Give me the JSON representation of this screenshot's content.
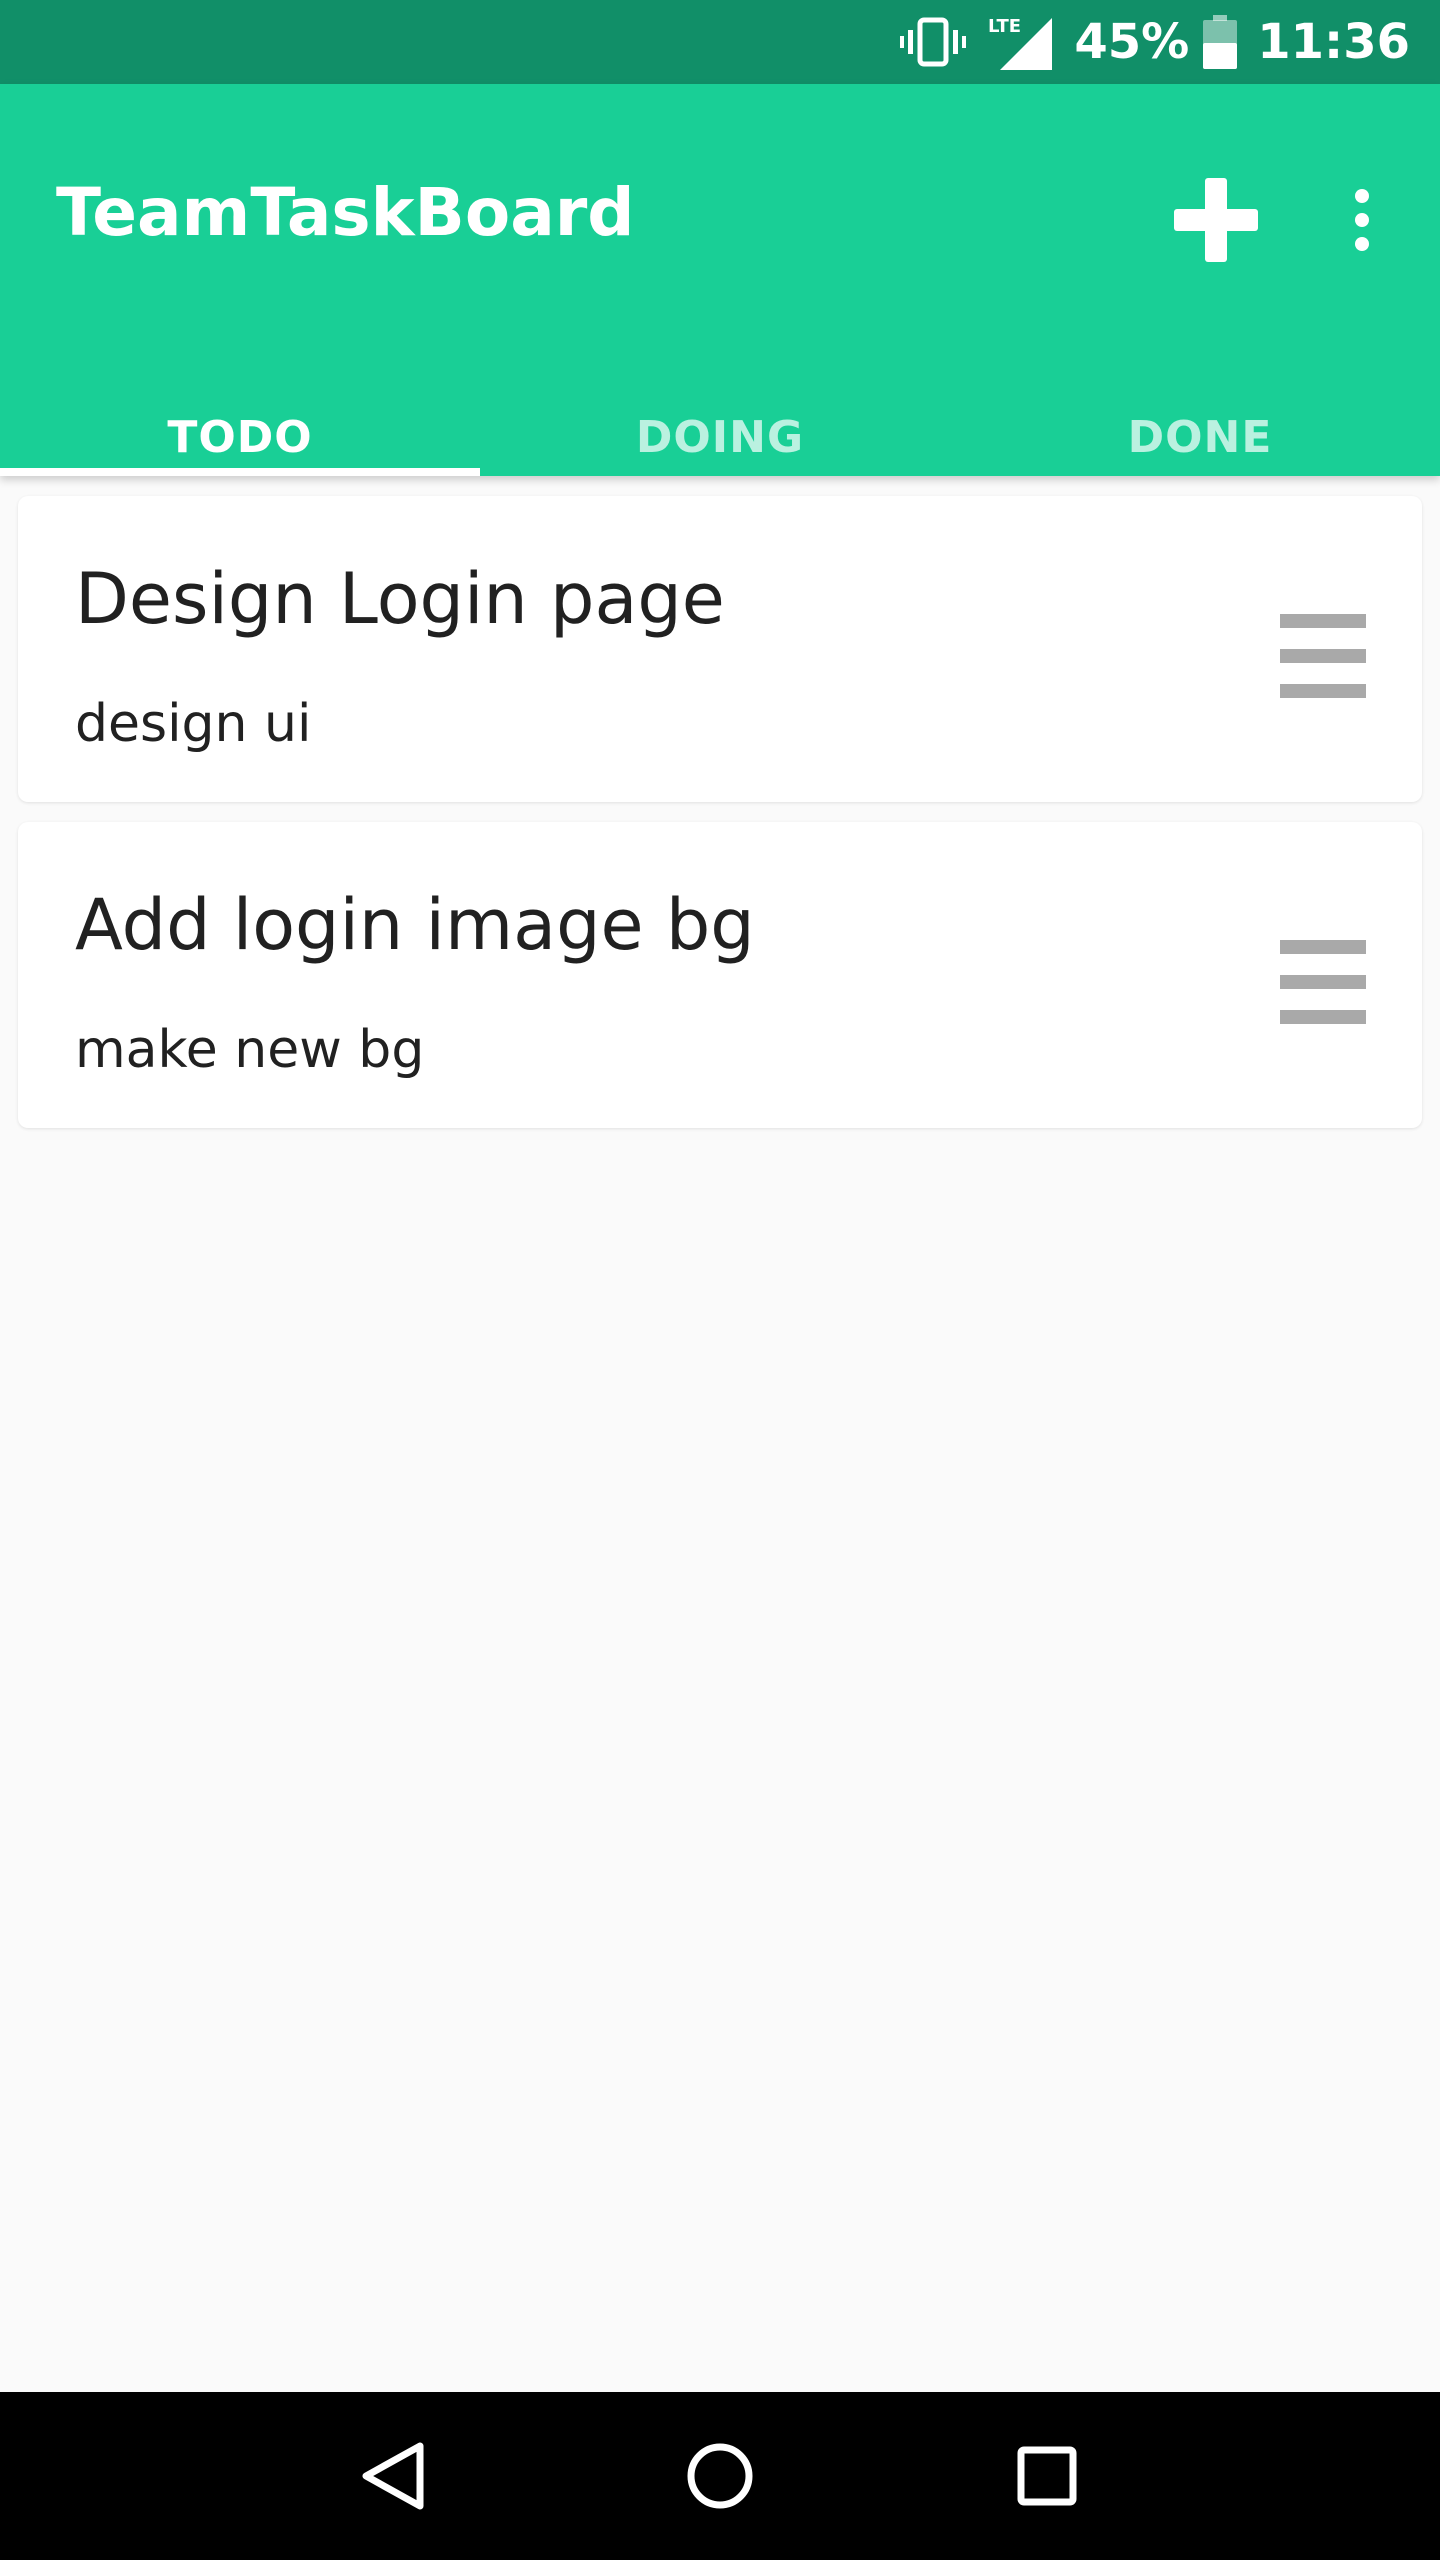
{
  "status_bar": {
    "battery_percent": "45%",
    "time": "11:36",
    "network": "LTE",
    "icons": [
      "vibrate-icon",
      "lte-signal-icon",
      "battery-icon"
    ]
  },
  "app_bar": {
    "title": "TeamTaskBoard",
    "actions": [
      "add-icon",
      "more-vert-icon"
    ],
    "color": "#19cf96",
    "status_color": "#118f68"
  },
  "tabs": [
    {
      "label": "TODO",
      "active": true
    },
    {
      "label": "DOING",
      "active": false
    },
    {
      "label": "DONE",
      "active": false
    }
  ],
  "tasks": [
    {
      "title": "Design Login page",
      "description": "design ui"
    },
    {
      "title": "Add login image bg",
      "description": "make new bg"
    }
  ],
  "nav_bar": {
    "buttons": [
      "back-icon",
      "home-icon",
      "recents-icon"
    ]
  }
}
